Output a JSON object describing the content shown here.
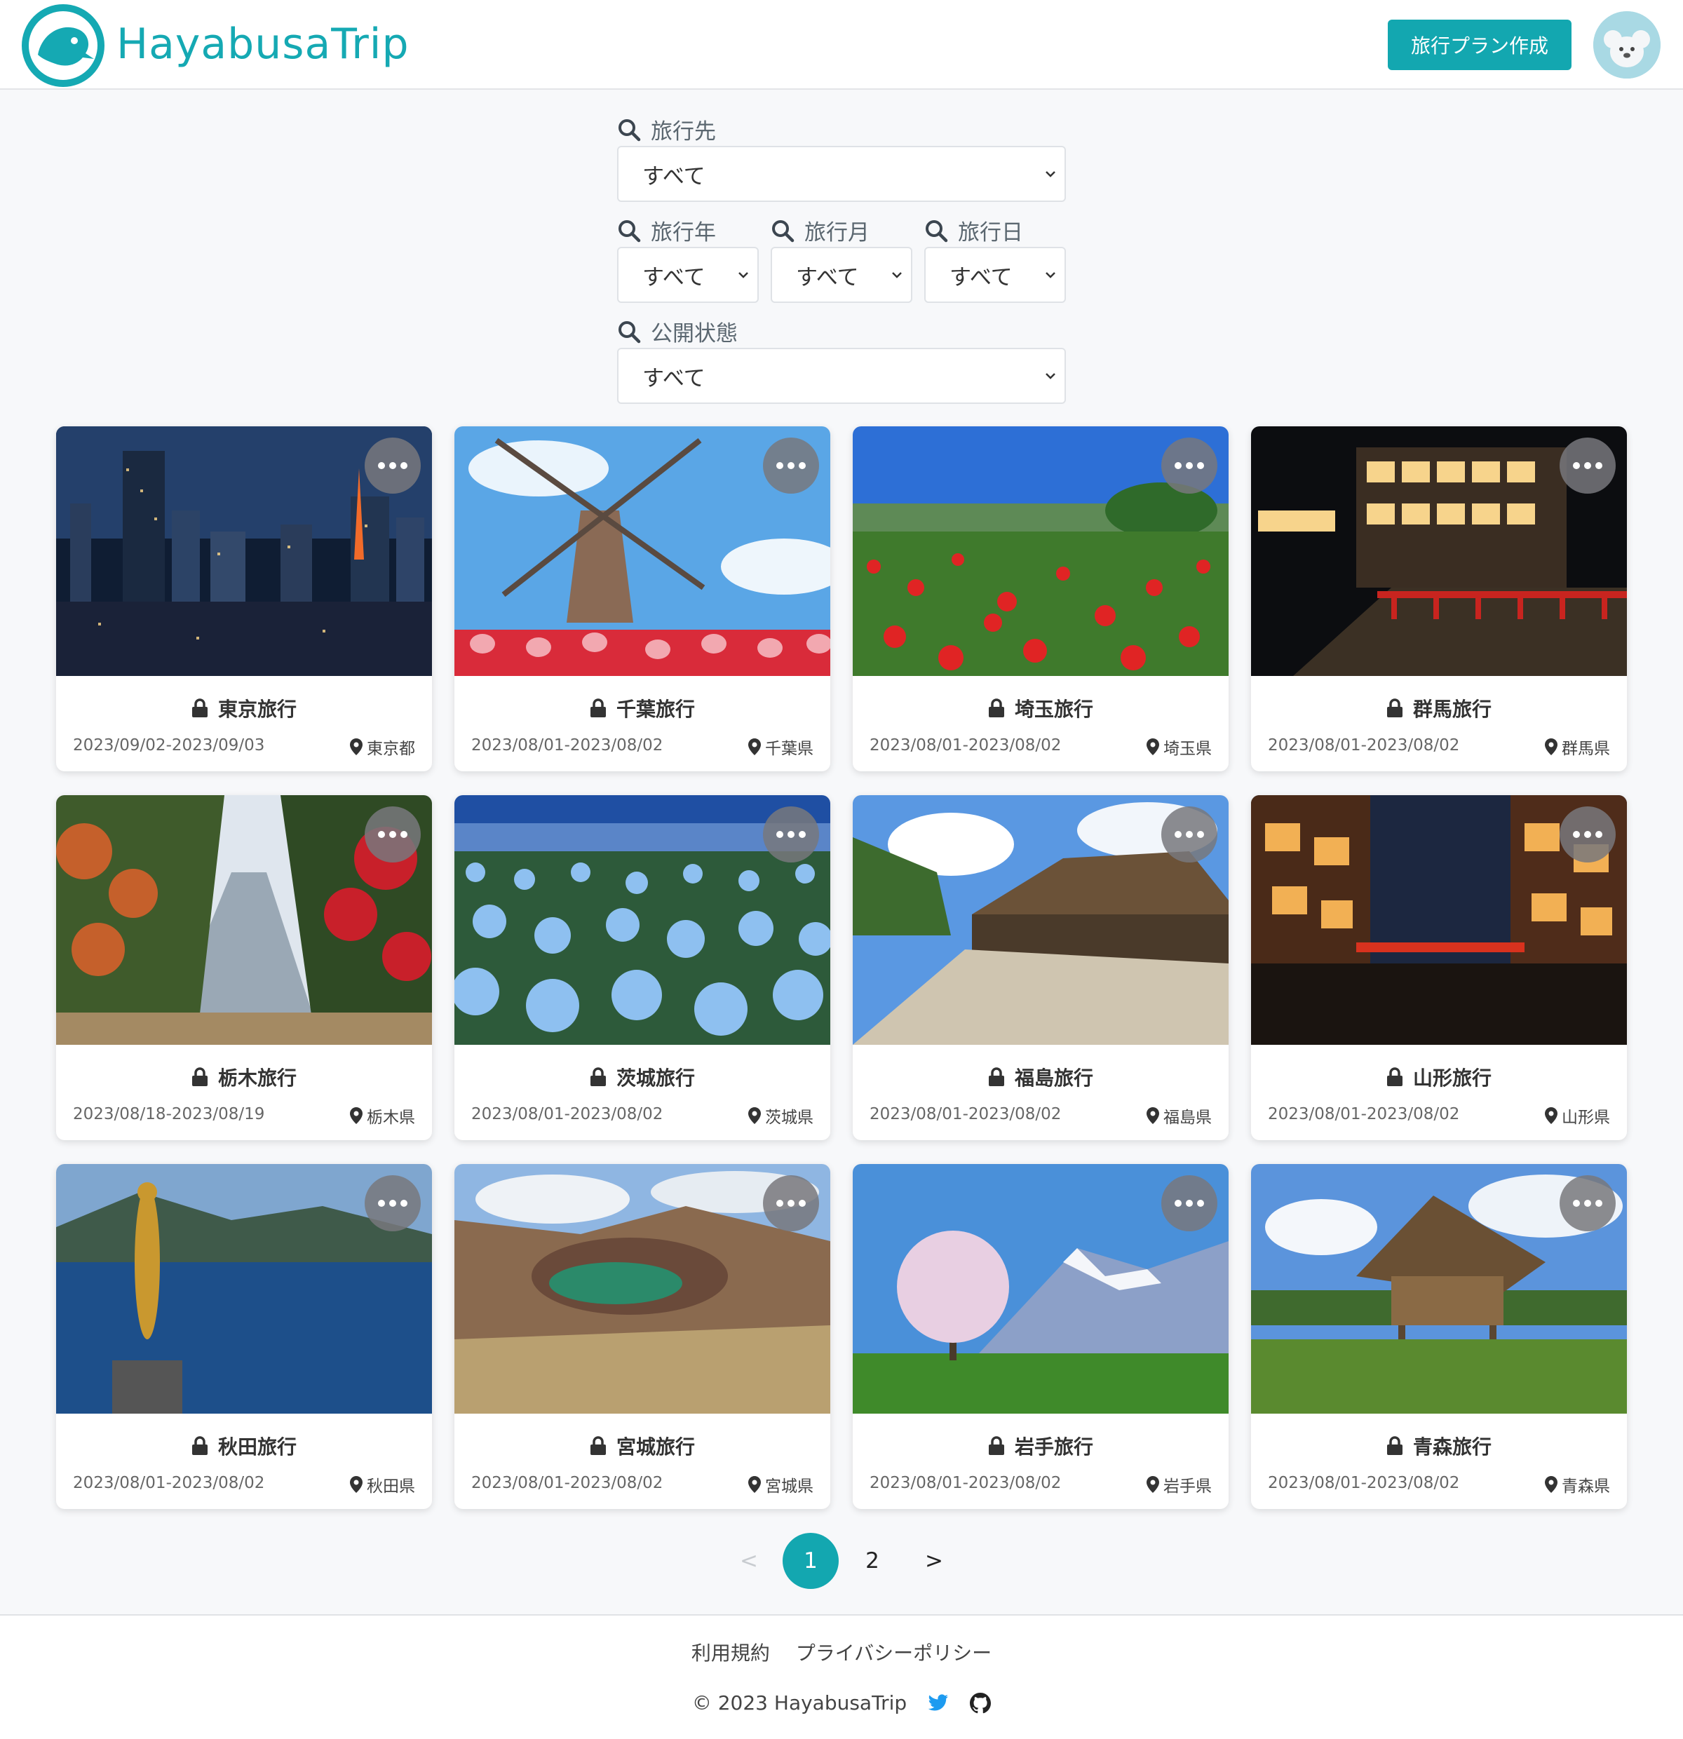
{
  "header": {
    "logo_text": "HayabusaTrip",
    "create_plan_label": "旅行プラン作成"
  },
  "filters": {
    "destination": {
      "label": "旅行先",
      "value": "すべて"
    },
    "year": {
      "label": "旅行年",
      "value": "すべて"
    },
    "month": {
      "label": "旅行月",
      "value": "すべて"
    },
    "day": {
      "label": "旅行日",
      "value": "すべて"
    },
    "visibility": {
      "label": "公開状態",
      "value": "すべて"
    }
  },
  "trips": [
    {
      "title": "東京旅行",
      "dates": "2023/09/02-2023/09/03",
      "prefecture": "東京都"
    },
    {
      "title": "千葉旅行",
      "dates": "2023/08/01-2023/08/02",
      "prefecture": "千葉県"
    },
    {
      "title": "埼玉旅行",
      "dates": "2023/08/01-2023/08/02",
      "prefecture": "埼玉県"
    },
    {
      "title": "群馬旅行",
      "dates": "2023/08/01-2023/08/02",
      "prefecture": "群馬県"
    },
    {
      "title": "栃木旅行",
      "dates": "2023/08/18-2023/08/19",
      "prefecture": "栃木県"
    },
    {
      "title": "茨城旅行",
      "dates": "2023/08/01-2023/08/02",
      "prefecture": "茨城県"
    },
    {
      "title": "福島旅行",
      "dates": "2023/08/01-2023/08/02",
      "prefecture": "福島県"
    },
    {
      "title": "山形旅行",
      "dates": "2023/08/01-2023/08/02",
      "prefecture": "山形県"
    },
    {
      "title": "秋田旅行",
      "dates": "2023/08/01-2023/08/02",
      "prefecture": "秋田県"
    },
    {
      "title": "宮城旅行",
      "dates": "2023/08/01-2023/08/02",
      "prefecture": "宮城県"
    },
    {
      "title": "岩手旅行",
      "dates": "2023/08/01-2023/08/02",
      "prefecture": "岩手県"
    },
    {
      "title": "青森旅行",
      "dates": "2023/08/01-2023/08/02",
      "prefecture": "青森県"
    }
  ],
  "pagination": {
    "prev": "<",
    "page1": "1",
    "page2": "2",
    "next": ">"
  },
  "footer": {
    "terms": "利用規約",
    "privacy": "プライバシーポリシー",
    "copyright": "© 2023 HayabusaTrip"
  },
  "colors": {
    "accent": "#13a7b0"
  },
  "icons": {
    "search": "search-icon",
    "chevron": "chevron-down-icon",
    "lock": "lock-icon",
    "pin": "map-pin-icon",
    "more": "more-icon",
    "twitter": "twitter-icon",
    "github": "github-icon"
  }
}
